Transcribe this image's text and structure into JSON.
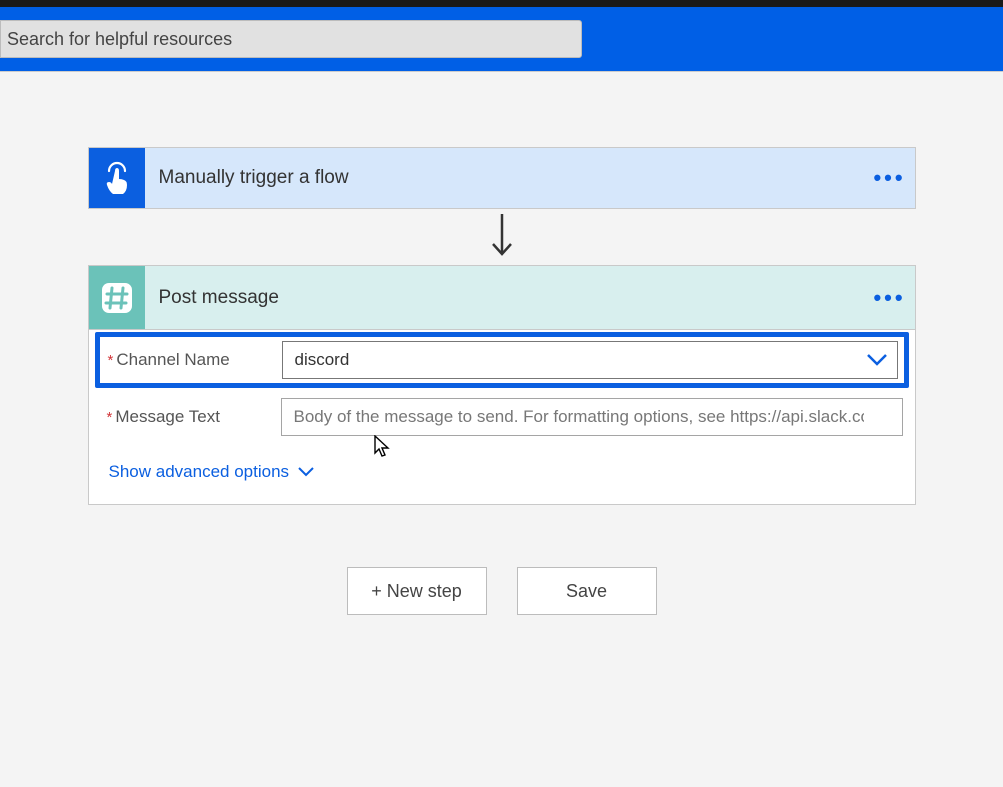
{
  "search": {
    "placeholder": "Search for helpful resources"
  },
  "trigger": {
    "title": "Manually trigger a flow"
  },
  "action": {
    "title": "Post message",
    "fields": {
      "channel": {
        "label": "Channel Name",
        "value": "discord"
      },
      "message": {
        "label": "Message Text",
        "placeholder": "Body of the message to send. For formatting options, see https://api.slack.com/"
      }
    },
    "advanced_label": "Show advanced options"
  },
  "footer": {
    "new_step": "+ New step",
    "save": "Save"
  }
}
